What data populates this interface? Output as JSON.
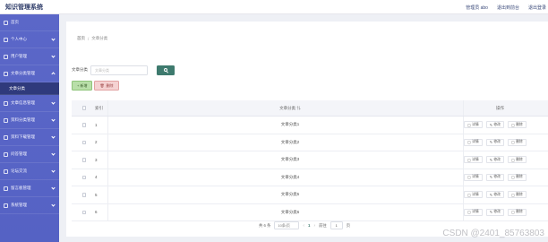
{
  "app": {
    "title": "知识管理系统"
  },
  "topbar": {
    "user": "管理员 abo",
    "back_front": "退出到前台",
    "logout": "退出登录"
  },
  "sidebar": {
    "items": [
      {
        "label": "首页",
        "icon": "home-icon",
        "open": false
      },
      {
        "label": "个人中心",
        "icon": "user-icon",
        "open": false
      },
      {
        "label": "用户管理",
        "icon": "users-icon",
        "open": false
      },
      {
        "label": "文章分类管理",
        "icon": "folder-icon",
        "open": true
      },
      {
        "label": "文章信息管理",
        "icon": "file-icon",
        "open": false
      },
      {
        "label": "资料分类管理",
        "icon": "folder-icon",
        "open": false
      },
      {
        "label": "资料下载管理",
        "icon": "download-icon",
        "open": false
      },
      {
        "label": "问答管理",
        "icon": "question-icon",
        "open": false
      },
      {
        "label": "论坛交流",
        "icon": "chat-icon",
        "open": false
      },
      {
        "label": "留言板管理",
        "icon": "message-icon",
        "open": false
      },
      {
        "label": "系统管理",
        "icon": "gear-icon",
        "open": false
      }
    ],
    "submenu": {
      "label": "文章分类"
    }
  },
  "breadcrumb": {
    "home": "首页",
    "separator": "/",
    "current": "文章分类"
  },
  "search": {
    "label": "文章分类",
    "placeholder": "文章分类",
    "button_icon": "search-icon"
  },
  "actions": {
    "add": "+ 新增",
    "delete": "删除"
  },
  "table": {
    "headers": {
      "index": "索引",
      "name": "文章分类",
      "ops": "操作"
    },
    "rows": [
      {
        "index": "1",
        "name": "文章分类1"
      },
      {
        "index": "2",
        "name": "文章分类2"
      },
      {
        "index": "3",
        "name": "文章分类3"
      },
      {
        "index": "4",
        "name": "文章分类4"
      },
      {
        "index": "5",
        "name": "文章分类5"
      },
      {
        "index": "6",
        "name": "文章分类6"
      }
    ],
    "row_actions": {
      "detail": "详情",
      "edit": "修改",
      "delete": "删除"
    }
  },
  "pager": {
    "total": "共 6 条",
    "page_size": "10条/页",
    "current_page": "1",
    "goto_label": "前往",
    "goto_value": "1",
    "page_unit": "页"
  },
  "watermark": "CSDN @2401_85763803",
  "colors": {
    "sidebar": "#5b67c8",
    "sidebar_active": "#2f3a7c",
    "search_button": "#3e7a6e",
    "add_button": "#b9dfa9",
    "delete_button": "#f5d2d2"
  }
}
